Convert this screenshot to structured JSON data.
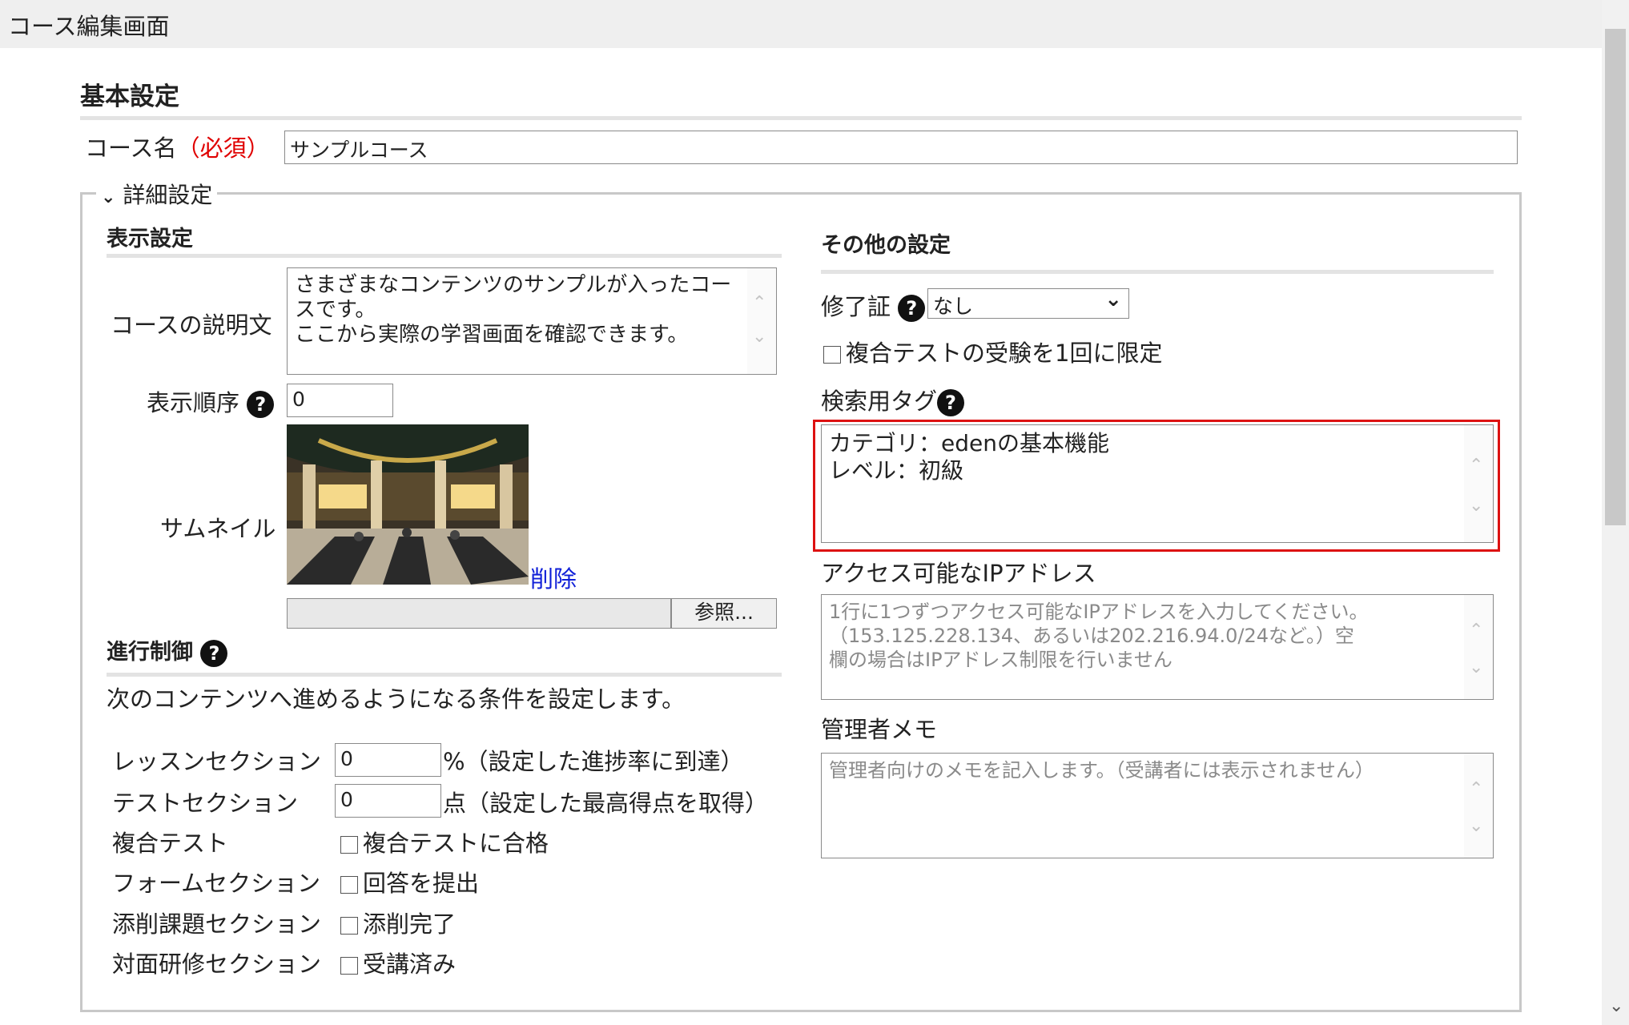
{
  "window": {
    "title": "コース編集画面"
  },
  "basic": {
    "heading": "基本設定",
    "course_name_label": "コース名",
    "required_label": "（必須）",
    "course_name_value": "サンプルコース"
  },
  "detail": {
    "legend": "詳細設定",
    "display": {
      "heading": "表示設定",
      "description_label": "コースの説明文",
      "description_lines": [
        "さまざまなコンテンツのサンプルが入ったコー",
        "スです。",
        "ここから実際の学習画面を確認できます。"
      ],
      "order_label": "表示順序",
      "order_value": "0",
      "thumbnail_label": "サムネイル",
      "delete_link": "削除",
      "browse_button": "参照..."
    },
    "progress": {
      "heading": "進行制御",
      "description": "次のコンテンツへ進めるようになる条件を設定します。",
      "lesson_label": "レッスンセクション",
      "lesson_value": "0",
      "lesson_suffix": "%（設定した進捗率に到達）",
      "test_label": "テストセクション",
      "test_value": "0",
      "test_suffix": "点（設定した最高得点を取得）",
      "composite_label": "複合テスト",
      "composite_check": "複合テストに合格",
      "form_label": "フォームセクション",
      "form_check": "回答を提出",
      "correction_label": "添削課題セクション",
      "correction_check": "添削完了",
      "f2f_label": "対面研修セクション",
      "f2f_check": "受講済み"
    },
    "other": {
      "heading": "その他の設定",
      "certificate_label": "修了証",
      "certificate_value": "なし",
      "composite_limit_check": "複合テストの受験を1回に限定",
      "tags_label": "検索用タグ",
      "tags_lines": [
        "カテゴリ：edenの基本機能",
        "レベル：初級"
      ],
      "ip_label": "アクセス可能なIPアドレス",
      "ip_placeholder_lines": [
        "1行に1つずつアクセス可能なIPアドレスを入力してください。",
        "（153.125.228.134、あるいは202.216.94.0/24など。）空",
        "欄の場合はIPアドレス制限を行いません"
      ],
      "memo_label": "管理者メモ",
      "memo_placeholder": "管理者向けのメモを記入します。（受講者には表示されません）"
    }
  },
  "help_icon_glyph": "?",
  "colors": {
    "highlight": "#dd1111",
    "required": "#e00000",
    "link": "#1020d8"
  }
}
